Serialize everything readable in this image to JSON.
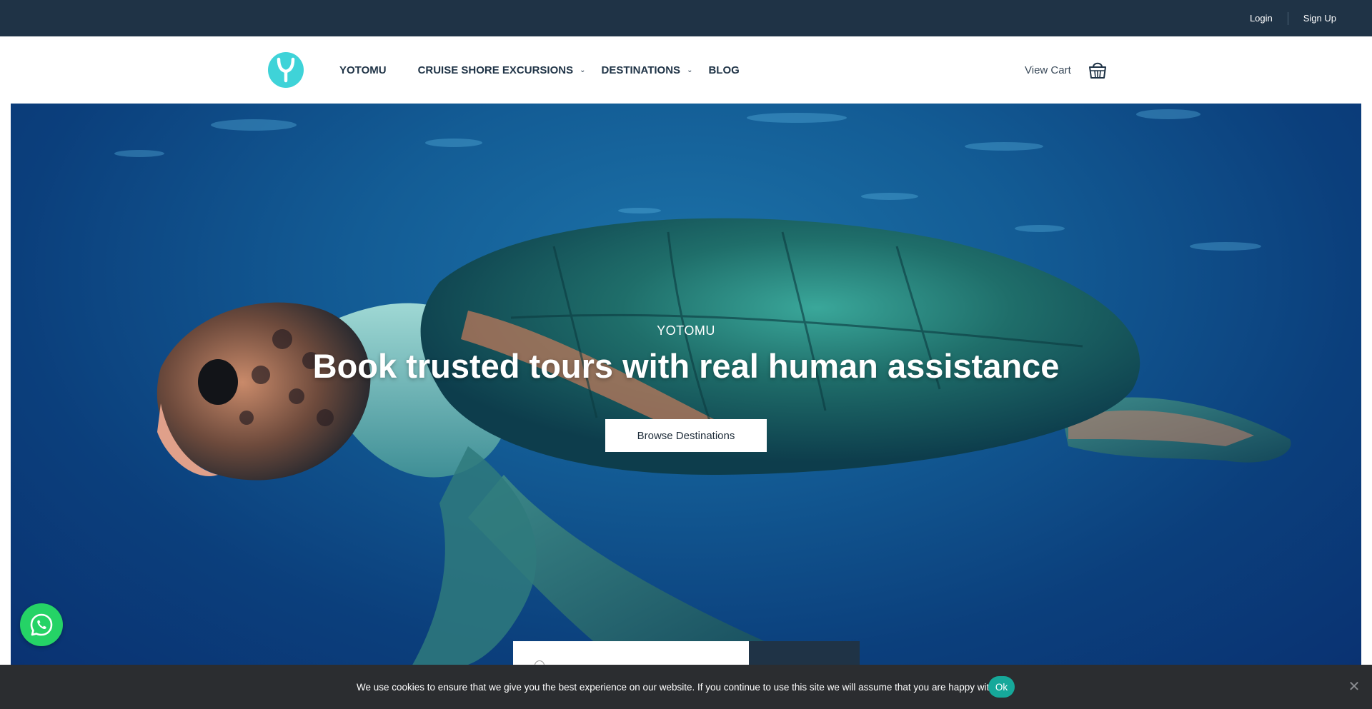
{
  "topbar": {
    "login": "Login",
    "signup": "Sign Up"
  },
  "header": {
    "nav": [
      {
        "label": "YOTOMU",
        "dropdown": false
      },
      {
        "label": "CRUISE SHORE EXCURSIONS",
        "dropdown": true
      },
      {
        "label": "DESTINATIONS",
        "dropdown": true
      },
      {
        "label": "BLOG",
        "dropdown": false
      }
    ],
    "view_cart": "View Cart",
    "logo_color": "#3fd3d8"
  },
  "hero": {
    "eyebrow": "YOTOMU",
    "title": "Book trusted tours with real human assistance",
    "button": "Browse Destinations",
    "image_subject": "sea-turtle-underwater"
  },
  "cookie": {
    "message": "We use cookies to ensure that we give you the best experience on our website. If you continue to use this site we will assume that you are happy with it.",
    "ok": "Ok",
    "close": "✕"
  },
  "colors": {
    "topbar": "#1f3346",
    "accent": "#16a89a",
    "whatsapp": "#25d366"
  }
}
